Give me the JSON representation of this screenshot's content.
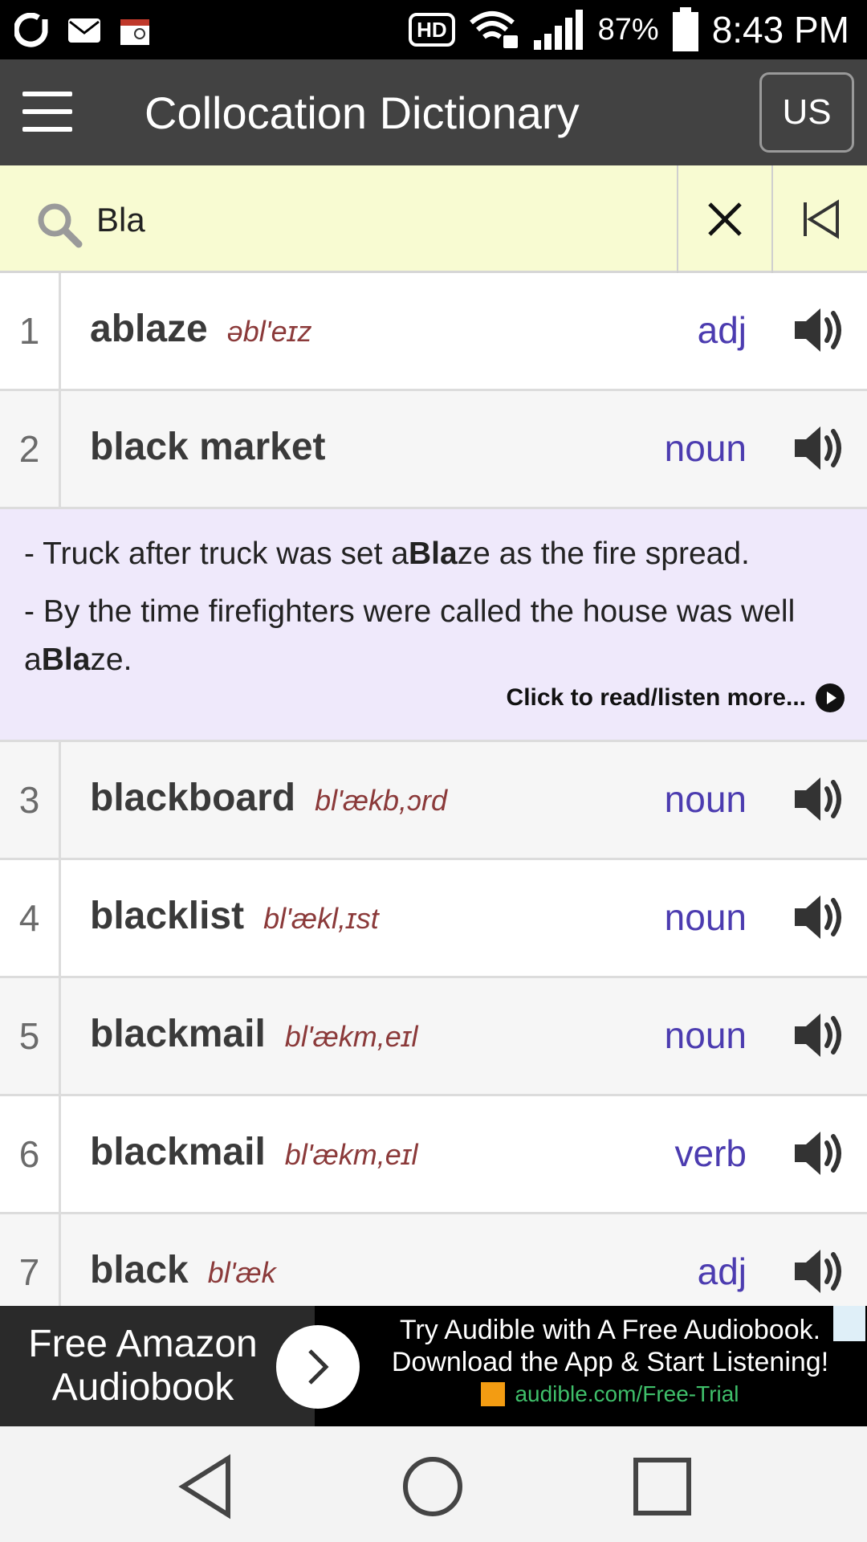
{
  "status_bar": {
    "battery": "87%",
    "time": "8:43 PM",
    "hd": "HD"
  },
  "app_bar": {
    "title": "Collocation Dictionary",
    "region": "US"
  },
  "search": {
    "value": "Bla"
  },
  "entries": [
    {
      "num": "1",
      "word": "ablaze",
      "ipa": "əbl'eɪz",
      "pos": "adj"
    },
    {
      "num": "2",
      "word": "black market",
      "ipa": "",
      "pos": "noun"
    },
    {
      "num": "3",
      "word": "blackboard",
      "ipa": "bl'ækb,ɔrd",
      "pos": "noun"
    },
    {
      "num": "4",
      "word": "blacklist",
      "ipa": "bl'ækl,ɪst",
      "pos": "noun"
    },
    {
      "num": "5",
      "word": "blackmail",
      "ipa": "bl'ækm,eɪl",
      "pos": "noun"
    },
    {
      "num": "6",
      "word": "blackmail",
      "ipa": "bl'ækm,eɪl",
      "pos": "verb"
    },
    {
      "num": "7",
      "word": "black",
      "ipa": "bl'æk",
      "pos": "adj"
    }
  ],
  "example": {
    "line1_pre": "- Truck after truck was set a",
    "line1_bold": "Bla",
    "line1_post": "ze as the fire spread.",
    "line2_pre": "- By the time firefighters were called the house was well a",
    "line2_bold": "Bla",
    "line2_post": "ze.",
    "read_more": "Click to read/listen more..."
  },
  "ad": {
    "left_text": "Free Amazon Audiobook",
    "line1": "Try Audible with A Free Audiobook.",
    "line2": "Download the App & Start Listening!",
    "url": "audible.com/Free-Trial"
  },
  "icons": {
    "menu": "hamburger-menu-icon",
    "search": "search-icon",
    "clear": "close-icon",
    "first": "skip-to-start-icon",
    "speaker": "speaker-icon"
  },
  "colors": {
    "app_bar": "#424242",
    "search_bg": "#f8fbd2",
    "example_bg": "#efe9fb",
    "pos": "#4c3cb0",
    "ipa": "#8b3a3a"
  }
}
